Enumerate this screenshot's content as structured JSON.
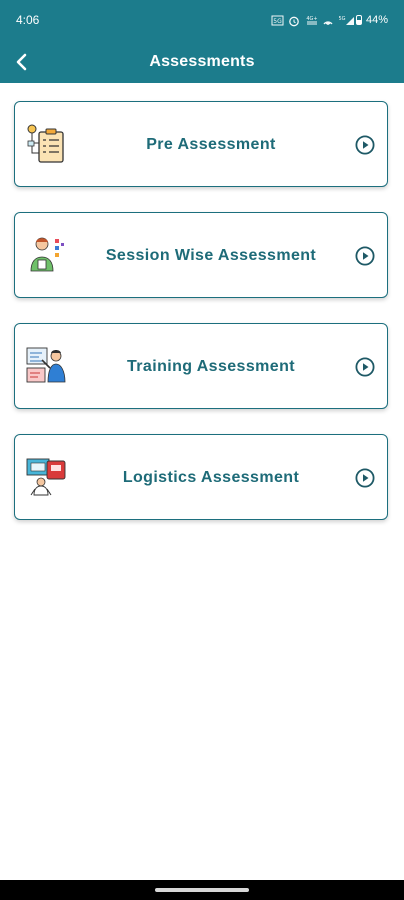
{
  "status_bar": {
    "time": "4:06",
    "battery": "44%",
    "icons": [
      "data-saver-icon",
      "alarm-icon",
      "volte-icon",
      "hotspot-icon",
      "signal-icon",
      "battery-icon"
    ],
    "indicator_labels": [
      "5G",
      "4G+"
    ]
  },
  "app_bar": {
    "title": "Assessments",
    "back_icon": "chevron-left-icon"
  },
  "colors": {
    "primary": "#1c7c8c",
    "card_text": "#1e6b78",
    "card_border": "#1c6f7e"
  },
  "cards": [
    {
      "label": "Pre Assessment",
      "icon": "checklist-icon",
      "action_icon": "play-circle-icon"
    },
    {
      "label": "Session Wise Assessment",
      "icon": "teacher-icon",
      "action_icon": "play-circle-icon"
    },
    {
      "label": "Training Assessment",
      "icon": "presentation-icon",
      "action_icon": "play-circle-icon"
    },
    {
      "label": "Logistics Assessment",
      "icon": "logistics-icon",
      "action_icon": "play-circle-icon"
    }
  ]
}
